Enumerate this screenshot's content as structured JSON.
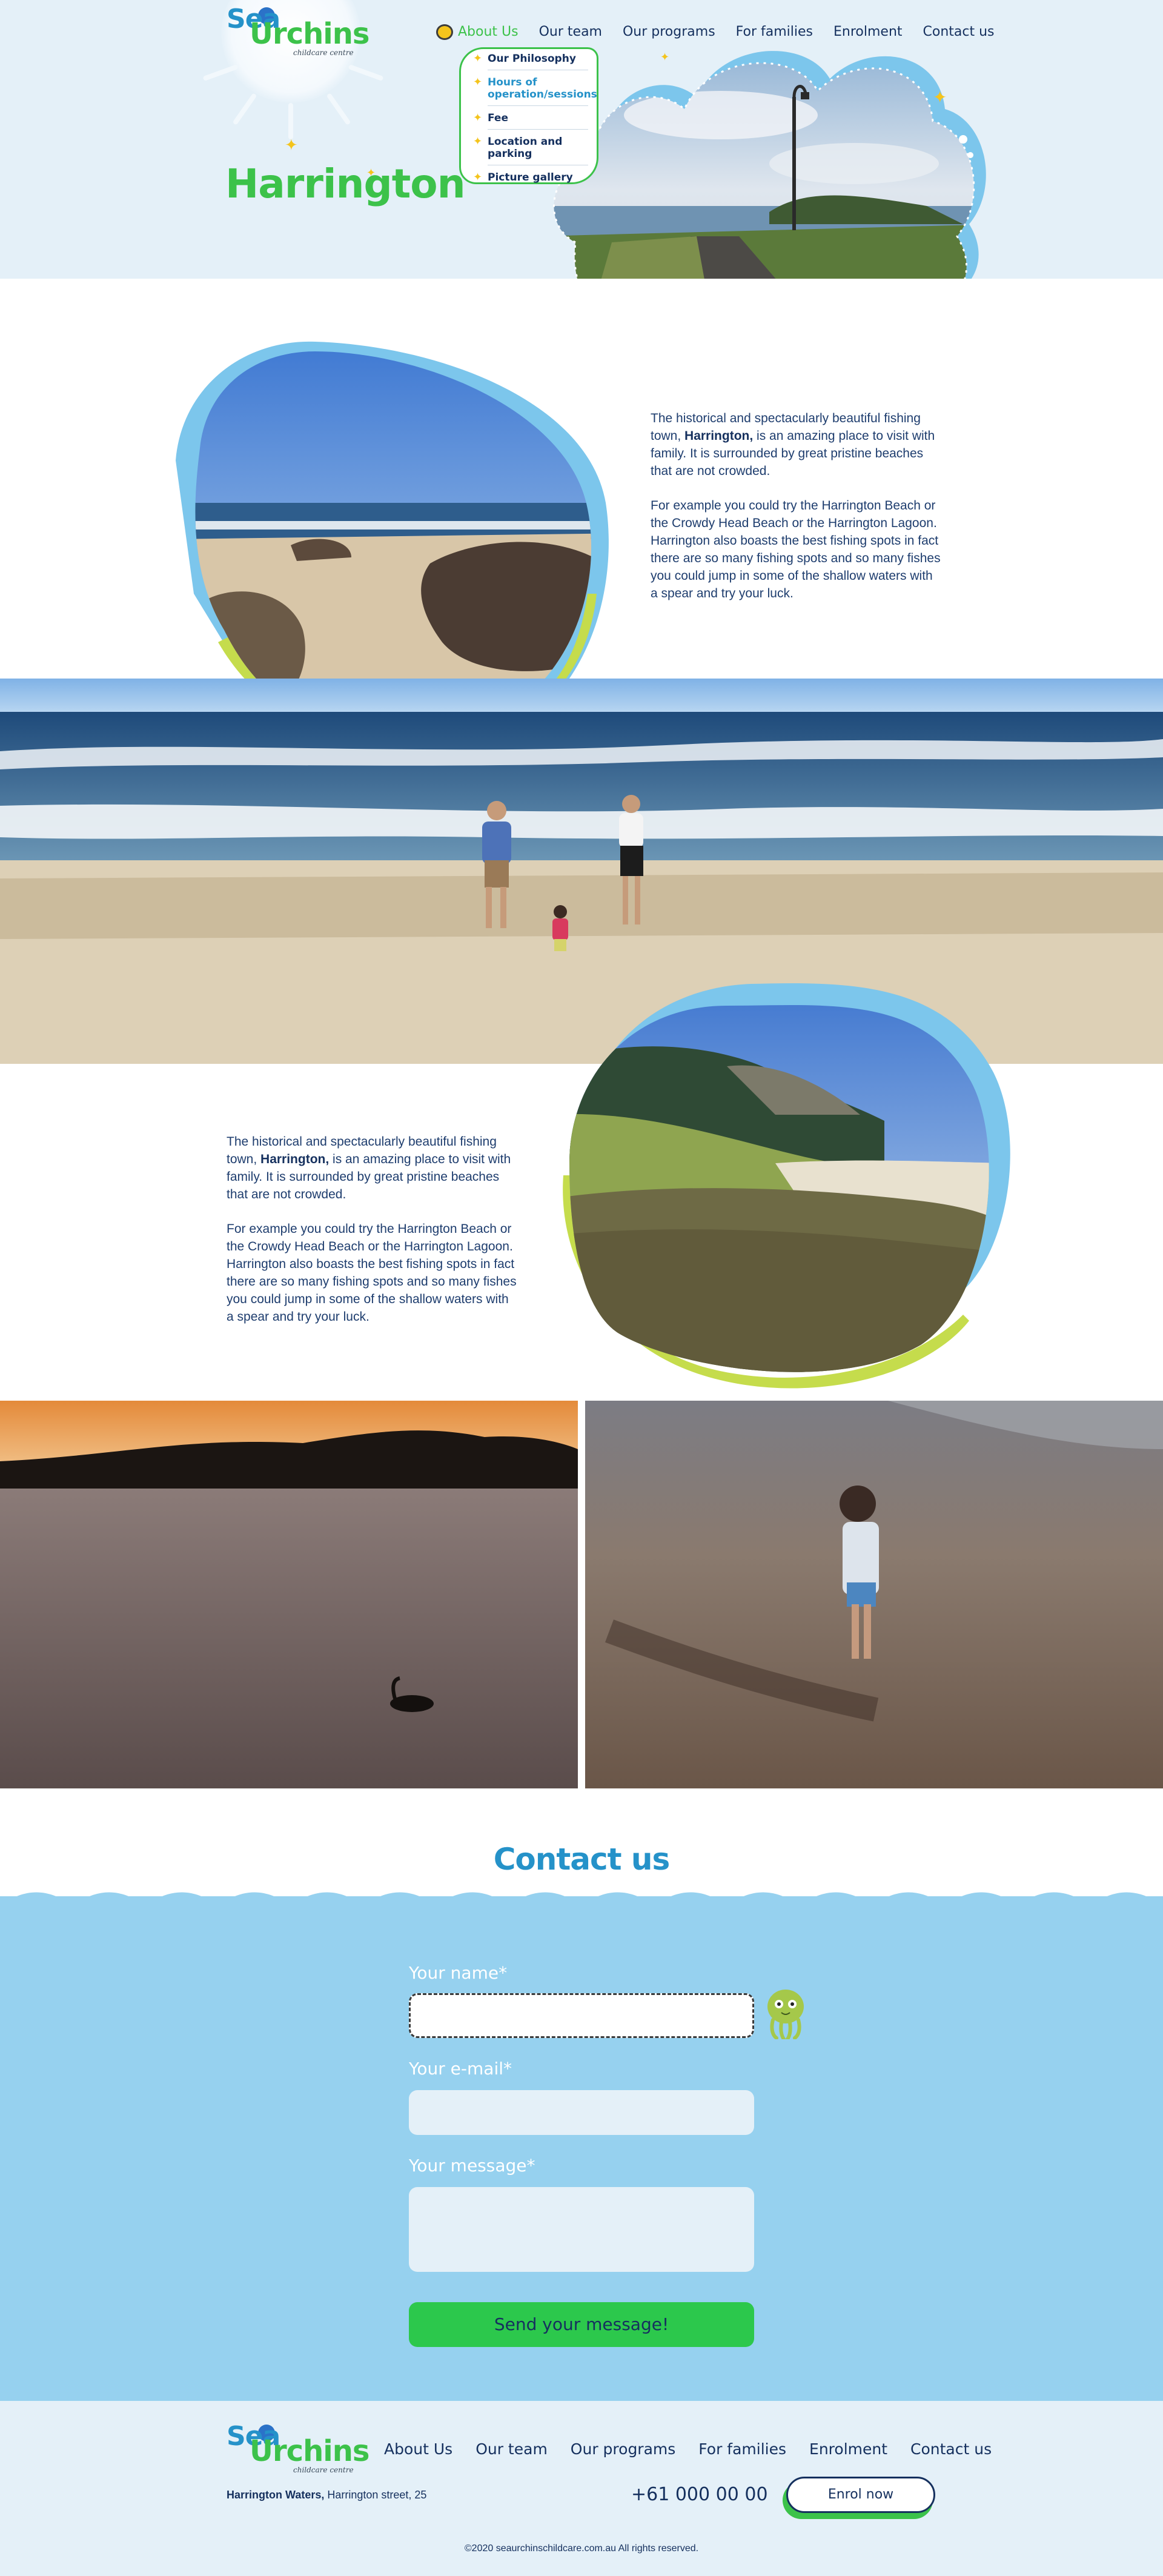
{
  "brand": {
    "logo_sea": "Sea",
    "logo_urchins": "Urchins",
    "logo_sub": "childcare centre"
  },
  "nav": {
    "items": [
      {
        "label": "About Us",
        "active": true
      },
      {
        "label": "Our team"
      },
      {
        "label": "Our programs"
      },
      {
        "label": "For families"
      },
      {
        "label": "Enrolment"
      },
      {
        "label": "Contact us"
      }
    ],
    "dropdown": [
      {
        "label": "Our Philosophy"
      },
      {
        "label": "Hours of operation/sessions",
        "active": true
      },
      {
        "label": "Fee"
      },
      {
        "label": "Location and parking"
      },
      {
        "label": "Picture gallery"
      }
    ]
  },
  "page": {
    "title": "Harrington"
  },
  "section1": {
    "p1_pre": "The historical and spectacularly beautiful fishing town, ",
    "p1_bold": "Harrington,",
    "p1_post": " is an amazing place to visit with family. It is surrounded by great pristine beaches that are not crowded.",
    "p2": "For example you could try the Harrington Beach or the Crowdy Head Beach or the Harrington Lagoon. Harrington also boasts the best fishing spots in fact there are so many fishing spots and so many fishes you could jump in some of the shallow waters with a spear and try your luck."
  },
  "section2": {
    "p1_pre": "The historical and spectacularly beautiful fishing town, ",
    "p1_bold": "Harrington,",
    "p1_post": " is an amazing place to visit with family. It is surrounded by great pristine beaches that are not crowded.",
    "p2": "For example you could try the Harrington Beach or the Crowdy Head Beach or the Harrington Lagoon. Harrington also boasts the best fishing spots in fact there are so many fishing spots and so many fishes you could jump in some of the shallow waters with a spear and try your luck."
  },
  "contact": {
    "title": "Contact us",
    "name_label": "Your name*",
    "email_label": "Your e-mail*",
    "message_label": "Your message*",
    "submit_label": "Send your message!"
  },
  "footer": {
    "nav": [
      "About Us",
      "Our team",
      "Our programs",
      "For families",
      "Enrolment",
      "Contact us"
    ],
    "address_bold": "Harrington Waters,",
    "address_rest": " Harrington street, 25",
    "phone": "+61 000 00 00",
    "enrol_label": "Enrol now",
    "copyright": "©2020 seaurchinschildcare.com.au All rights reserved."
  },
  "colors": {
    "green": "#3cc24a",
    "blue": "#2592c9",
    "navy": "#15305e",
    "sky": "#96d1ef",
    "pale": "#e4f0f8",
    "lime": "#c5dc4c"
  }
}
